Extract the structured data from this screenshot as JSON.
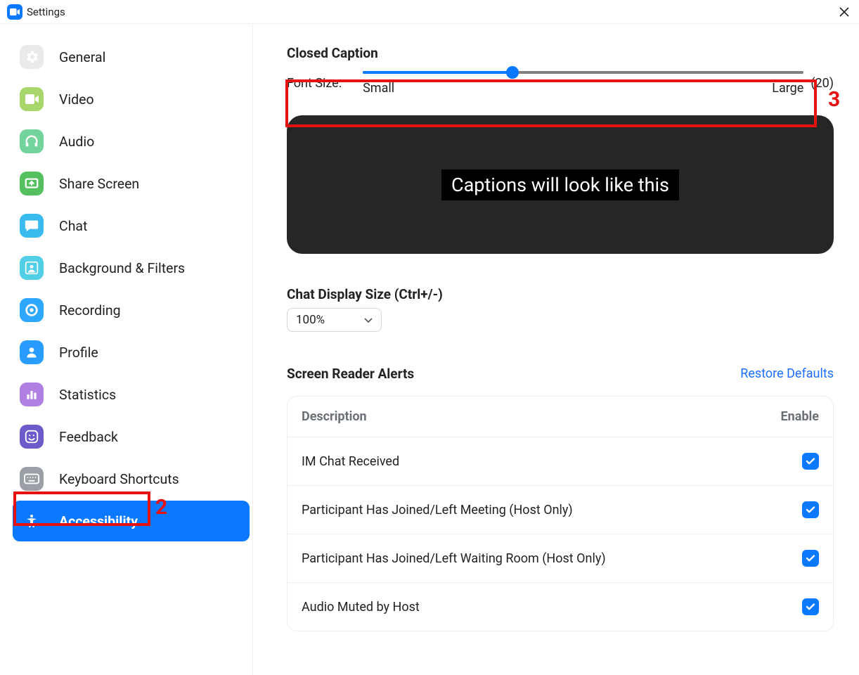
{
  "window": {
    "title": "Settings"
  },
  "sidebar": {
    "items": [
      {
        "label": "General"
      },
      {
        "label": "Video"
      },
      {
        "label": "Audio"
      },
      {
        "label": "Share Screen"
      },
      {
        "label": "Chat"
      },
      {
        "label": "Background & Filters"
      },
      {
        "label": "Recording"
      },
      {
        "label": "Profile"
      },
      {
        "label": "Statistics"
      },
      {
        "label": "Feedback"
      },
      {
        "label": "Keyboard Shortcuts"
      },
      {
        "label": "Accessibility"
      }
    ],
    "active_index": 11
  },
  "annotations": {
    "label_2": "2",
    "label_3": "3"
  },
  "closed_caption": {
    "heading": "Closed Caption",
    "font_size_label": "Font Size:",
    "small_label": "Small",
    "large_label": "Large",
    "value_display": "(20)",
    "value": 20,
    "slider_percent": 34,
    "preview_text": "Captions will look like this"
  },
  "chat_display": {
    "heading": "Chat Display Size (Ctrl+/-)",
    "value": "100%"
  },
  "screen_reader": {
    "heading": "Screen Reader Alerts",
    "restore": "Restore Defaults",
    "columns": {
      "desc": "Description",
      "enable": "Enable"
    },
    "rows": [
      {
        "desc": "IM Chat Received",
        "enabled": true
      },
      {
        "desc": "Participant Has Joined/Left Meeting (Host Only)",
        "enabled": true
      },
      {
        "desc": "Participant Has Joined/Left Waiting Room (Host Only)",
        "enabled": true
      },
      {
        "desc": "Audio Muted by Host",
        "enabled": true
      }
    ]
  }
}
